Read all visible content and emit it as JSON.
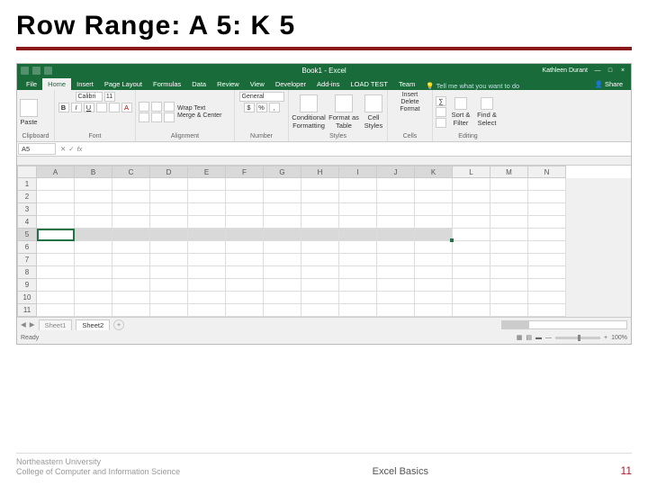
{
  "slide": {
    "title": "Row Range: A 5: K 5",
    "footer_left_main": "Northeastern University",
    "footer_left_sub": "College of Computer and Information Science",
    "footer_center": "Excel Basics",
    "page_number": "11"
  },
  "titlebar": {
    "doc_title": "Book1 - Excel",
    "user": "Kathleen Durant",
    "min": "—",
    "max": "□",
    "close": "×"
  },
  "tabs": {
    "file": "File",
    "home": "Home",
    "insert": "Insert",
    "pagelayout": "Page Layout",
    "formulas": "Formulas",
    "data": "Data",
    "review": "Review",
    "view": "View",
    "developer": "Developer",
    "addins": "Add-ins",
    "loadtest": "LOAD TEST",
    "team": "Team",
    "tellme": "Tell me what you want to do",
    "share": "Share"
  },
  "ribbon": {
    "paste": "Paste",
    "clipboard": "Clipboard",
    "font_name": "Calibri",
    "font_size": "11",
    "font": "Font",
    "wrap": "Wrap Text",
    "merge": "Merge & Center",
    "alignment": "Alignment",
    "format_general": "General",
    "number": "Number",
    "cond": "Conditional Formatting",
    "fmt_as": "Format as Table",
    "cell_styles": "Cell Styles",
    "styles": "Styles",
    "insert": "Insert",
    "delete": "Delete",
    "format": "Format",
    "cells": "Cells",
    "sort": "Sort & Filter",
    "find": "Find & Select",
    "editing": "Editing"
  },
  "fxbar": {
    "name_box": "A5",
    "cancel": "✕",
    "enter": "✓",
    "fx": "fx"
  },
  "grid": {
    "columns": [
      "A",
      "B",
      "C",
      "D",
      "E",
      "F",
      "G",
      "H",
      "I",
      "J",
      "K",
      "L",
      "M",
      "N"
    ],
    "rows": [
      "1",
      "2",
      "3",
      "4",
      "5",
      "6",
      "7",
      "8",
      "9",
      "10",
      "11"
    ],
    "selected_row": 5,
    "selected_cols_end": 11,
    "active_cell": "A5"
  },
  "sheets": {
    "sheet1": "Sheet1",
    "sheet2": "Sheet2",
    "add": "+"
  },
  "status": {
    "ready": "Ready",
    "zoom": "100%",
    "plus": "+",
    "minus": "—"
  }
}
